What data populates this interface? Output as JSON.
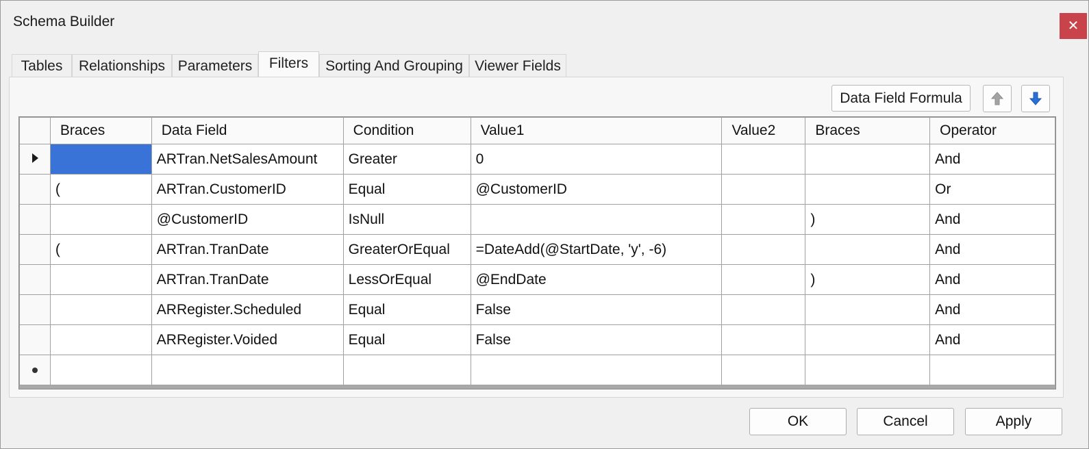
{
  "window": {
    "title": "Schema Builder",
    "close_glyph": "✕"
  },
  "tabs": [
    {
      "label": "Tables"
    },
    {
      "label": "Relationships"
    },
    {
      "label": "Parameters"
    },
    {
      "label": "Filters",
      "active": true
    },
    {
      "label": "Sorting And Grouping"
    },
    {
      "label": "Viewer Fields"
    }
  ],
  "toolbar": {
    "formula_label": "Data Field Formula",
    "up_icon": "arrow-up-icon",
    "down_icon": "arrow-down-icon",
    "down_color": "#2a6fd6"
  },
  "grid": {
    "columns": [
      "Braces",
      "Data Field",
      "Condition",
      "Value1",
      "Value2",
      "Braces",
      "Operator"
    ],
    "rows": [
      {
        "indicator": "current",
        "cells": [
          "",
          "ARTran.NetSalesAmount",
          "Greater",
          "0",
          "",
          "",
          "And"
        ]
      },
      {
        "indicator": "",
        "cells": [
          "(",
          "ARTran.CustomerID",
          "Equal",
          "@CustomerID",
          "",
          "",
          "Or"
        ]
      },
      {
        "indicator": "",
        "cells": [
          "",
          "@CustomerID",
          "IsNull",
          "",
          "",
          ")",
          "And"
        ]
      },
      {
        "indicator": "",
        "cells": [
          "(",
          "ARTran.TranDate",
          "GreaterOrEqual",
          "=DateAdd(@StartDate, 'y', -6)",
          "",
          "",
          "And"
        ]
      },
      {
        "indicator": "",
        "cells": [
          "",
          "ARTran.TranDate",
          "LessOrEqual",
          "@EndDate",
          "",
          ")",
          "And"
        ]
      },
      {
        "indicator": "",
        "cells": [
          "",
          "ARRegister.Scheduled",
          "Equal",
          "False",
          "",
          "",
          "And"
        ]
      },
      {
        "indicator": "",
        "cells": [
          "",
          "ARRegister.Voided",
          "Equal",
          "False",
          "",
          "",
          "And"
        ]
      },
      {
        "indicator": "new",
        "cells": [
          "",
          "",
          "",
          "",
          "",
          "",
          ""
        ]
      }
    ],
    "selection_color": "#3a73d8"
  },
  "footer": {
    "ok_label": "OK",
    "cancel_label": "Cancel",
    "apply_label": "Apply"
  }
}
